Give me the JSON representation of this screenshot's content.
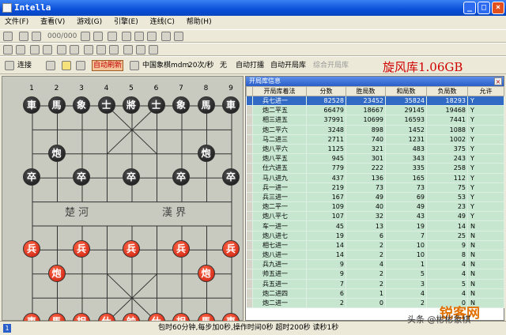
{
  "window": {
    "title": "Intella"
  },
  "menu": [
    "文件(F)",
    "查看(V)",
    "游戏(G)",
    "引擎(E)",
    "连线(C)",
    "帮助(H)"
  ],
  "toolbar1": {
    "counter": "000/000"
  },
  "toolbar3": {
    "connect": "连接",
    "auto_refresh": "自动刷新",
    "engine": "中国象棋mdm",
    "speed": "20次/秒",
    "none": "无",
    "auto_hit": "自动打擂",
    "auto_book": "自动开局库",
    "book_compose": "综合开局库"
  },
  "book_title": "旋风库1.06GB",
  "board": {
    "columns": [
      "1",
      "2",
      "3",
      "4",
      "5",
      "6",
      "7",
      "8",
      "9"
    ],
    "black": [
      {
        "c": 0,
        "r": 0,
        "t": "車"
      },
      {
        "c": 1,
        "r": 0,
        "t": "馬"
      },
      {
        "c": 2,
        "r": 0,
        "t": "象"
      },
      {
        "c": 3,
        "r": 0,
        "t": "士"
      },
      {
        "c": 4,
        "r": 0,
        "t": "將"
      },
      {
        "c": 5,
        "r": 0,
        "t": "士"
      },
      {
        "c": 6,
        "r": 0,
        "t": "象"
      },
      {
        "c": 7,
        "r": 0,
        "t": "馬"
      },
      {
        "c": 8,
        "r": 0,
        "t": "車"
      },
      {
        "c": 1,
        "r": 2,
        "t": "炮"
      },
      {
        "c": 7,
        "r": 2,
        "t": "炮"
      },
      {
        "c": 0,
        "r": 3,
        "t": "卒"
      },
      {
        "c": 2,
        "r": 3,
        "t": "卒"
      },
      {
        "c": 4,
        "r": 3,
        "t": "卒"
      },
      {
        "c": 6,
        "r": 3,
        "t": "卒"
      },
      {
        "c": 8,
        "r": 3,
        "t": "卒"
      }
    ],
    "red": [
      {
        "c": 0,
        "r": 6,
        "t": "兵"
      },
      {
        "c": 2,
        "r": 6,
        "t": "兵"
      },
      {
        "c": 4,
        "r": 6,
        "t": "兵"
      },
      {
        "c": 6,
        "r": 6,
        "t": "兵"
      },
      {
        "c": 8,
        "r": 6,
        "t": "兵"
      },
      {
        "c": 1,
        "r": 7,
        "t": "炮"
      },
      {
        "c": 7,
        "r": 7,
        "t": "炮"
      },
      {
        "c": 0,
        "r": 9,
        "t": "車"
      },
      {
        "c": 1,
        "r": 9,
        "t": "馬"
      },
      {
        "c": 2,
        "r": 9,
        "t": "相"
      },
      {
        "c": 3,
        "r": 9,
        "t": "仕"
      },
      {
        "c": 4,
        "r": 9,
        "t": "帥"
      },
      {
        "c": 5,
        "r": 9,
        "t": "仕"
      },
      {
        "c": 6,
        "r": 9,
        "t": "相"
      },
      {
        "c": 7,
        "r": 9,
        "t": "馬"
      },
      {
        "c": 8,
        "r": 9,
        "t": "車"
      }
    ],
    "river_left": "楚 河",
    "river_right": "漢 界"
  },
  "panel": {
    "title": "开局库信息",
    "close": "×",
    "headers": [
      "开局库着法",
      "分数",
      "胜局数",
      "和局数",
      "负局数",
      "允许"
    ],
    "rows": [
      [
        "兵七进一",
        "82528",
        "23452",
        "35824",
        "18293",
        "Y"
      ],
      [
        "炮二平五",
        "66479",
        "18667",
        "29145",
        "19468",
        "Y"
      ],
      [
        "相三进五",
        "37991",
        "10699",
        "16593",
        "7441",
        "Y"
      ],
      [
        "炮二平六",
        "3248",
        "898",
        "1452",
        "1088",
        "Y"
      ],
      [
        "马二进三",
        "2711",
        "740",
        "1231",
        "1002",
        "Y"
      ],
      [
        "炮八平六",
        "1125",
        "321",
        "483",
        "375",
        "Y"
      ],
      [
        "炮八平五",
        "945",
        "301",
        "343",
        "243",
        "Y"
      ],
      [
        "仕六进五",
        "779",
        "222",
        "335",
        "258",
        "Y"
      ],
      [
        "马八进九",
        "437",
        "136",
        "165",
        "112",
        "Y"
      ],
      [
        "兵一进一",
        "219",
        "73",
        "73",
        "75",
        "Y"
      ],
      [
        "兵三进一",
        "167",
        "49",
        "69",
        "53",
        "Y"
      ],
      [
        "炮二平一",
        "109",
        "40",
        "49",
        "23",
        "Y"
      ],
      [
        "炮八平七",
        "107",
        "32",
        "43",
        "49",
        "Y"
      ],
      [
        "车一进一",
        "45",
        "13",
        "19",
        "14",
        "N"
      ],
      [
        "炮八进七",
        "19",
        "6",
        "7",
        "25",
        "N"
      ],
      [
        "相七进一",
        "14",
        "2",
        "10",
        "9",
        "N"
      ],
      [
        "炮八进一",
        "14",
        "2",
        "10",
        "8",
        "N"
      ],
      [
        "兵九进一",
        "9",
        "4",
        "1",
        "4",
        "N"
      ],
      [
        "帅五进一",
        "9",
        "2",
        "5",
        "4",
        "N"
      ],
      [
        "兵五进一",
        "7",
        "2",
        "3",
        "5",
        "N"
      ],
      [
        "炮二进四",
        "6",
        "1",
        "4",
        "4",
        "N"
      ],
      [
        "炮二进一",
        "2",
        "0",
        "2",
        "0",
        "N"
      ]
    ]
  },
  "status": "包时60分钟,每步加0秒,操作时间0秒 超时200秒 读秒1秒",
  "status_num": "1",
  "watermark": {
    "main": "锐客网",
    "sub": "头条 @彬彬象棋"
  },
  "colors": {
    "black_piece": "#111111",
    "red_piece": "#c81808",
    "table_row": "#c6e6d0",
    "title": "#d00000"
  }
}
